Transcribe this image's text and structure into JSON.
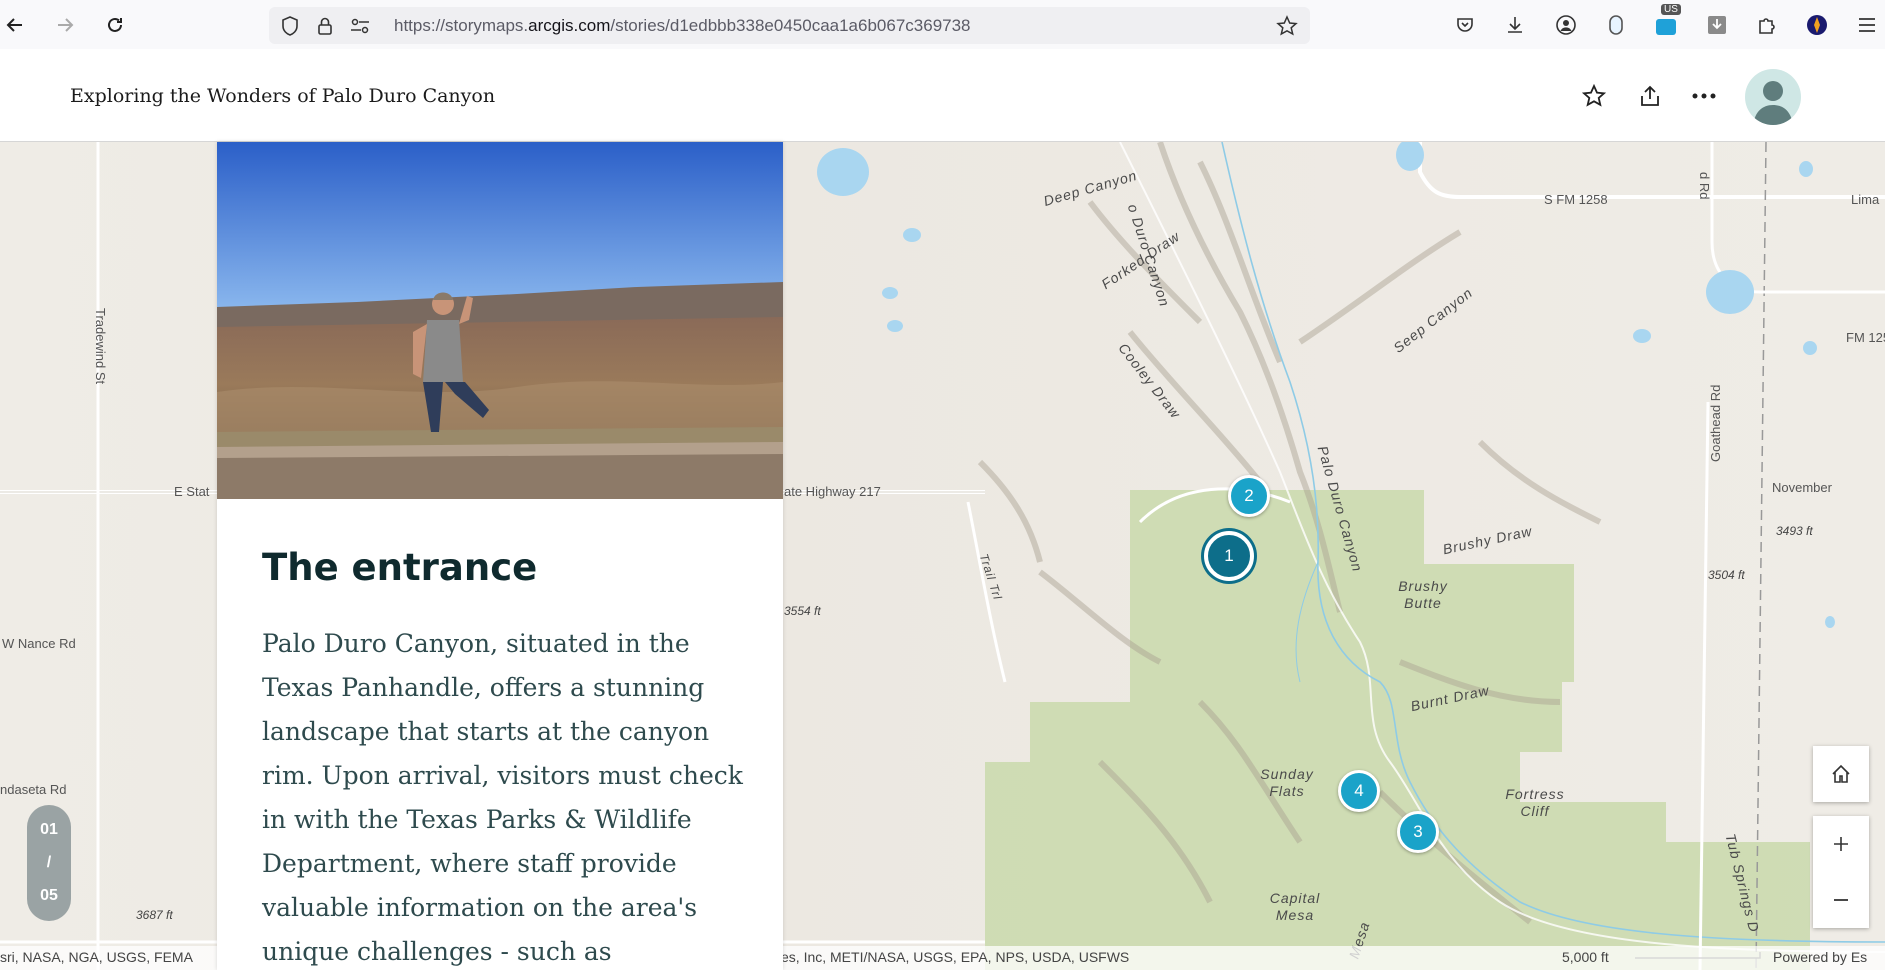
{
  "browser": {
    "url_prefix": "https://storymaps.",
    "url_domain": "arcgis.com",
    "url_path": "/stories/d1edbbb338e0450caa1a6b067c369738",
    "extension_badge": "US"
  },
  "story": {
    "title": "Exploring the Wonders of Palo Duro Canyon"
  },
  "card": {
    "heading": "The entrance",
    "body": "Palo Duro Canyon, situated in the Texas Panhandle, offers a stunning landscape that starts at the canyon rim. Upon arrival, visitors must check in with the Texas Parks & Wildlife Department, where staff provide valuable information on the area's unique challenges - such as"
  },
  "pager": {
    "current": "01",
    "sep": "/",
    "total": "05"
  },
  "markers": [
    {
      "label": "1",
      "active": true
    },
    {
      "label": "2",
      "active": false
    },
    {
      "label": "3",
      "active": false
    },
    {
      "label": "4",
      "active": false
    }
  ],
  "map": {
    "labels": {
      "deep_canyon": "Deep Canyon",
      "duro_canyon_top": "o Duro Canyon",
      "forked_draw": "Forked Draw",
      "cooley_draw": "Cooley Draw",
      "seep_canyon": "Seep Canyon",
      "palo_duro_canyon": "Palo Duro Canyon",
      "brushy_draw": "Brushy Draw",
      "brushy_butte": "Brushy Butte",
      "burnt_draw": "Burnt Draw",
      "sunday_flats": "Sunday Flats",
      "fortress_cliff": "Fortress Cliff",
      "capital_mesa": "Capital Mesa",
      "mesa": "Mesa",
      "trail_trl": "Trail Trl",
      "tub_springs": "Tub Springs D"
    },
    "roads": {
      "s_fm_1258": "S FM 1258",
      "lima": "Lima",
      "fm_125": "FM 125",
      "tradewind": "Tradewind St",
      "e_state": "E Stat",
      "state_hwy": "ate Highway 217",
      "november": "November",
      "goathead": "Goathead Rd",
      "w_nance": "W Nance Rd",
      "andaseta": "ndaseta Rd",
      "rd_top": "d Rd"
    },
    "elevations": {
      "e3493": "3493 ft",
      "e3504": "3504 ft",
      "e3554": "3554 ft",
      "e3687": "3687 ft"
    },
    "attribution_left": "sri, NASA, NGA, USGS, FEMA",
    "attribution_mid": "es, Inc, METI/NASA, USGS, EPA, NPS, USDA, USFWS",
    "scale": "5,000 ft",
    "powered_by": "Powered by Es"
  },
  "colors": {
    "marker": "#1aa3c9",
    "marker_active": "#0d6e8a",
    "park": "#c8d9a8",
    "water": "#a9d6f0"
  }
}
